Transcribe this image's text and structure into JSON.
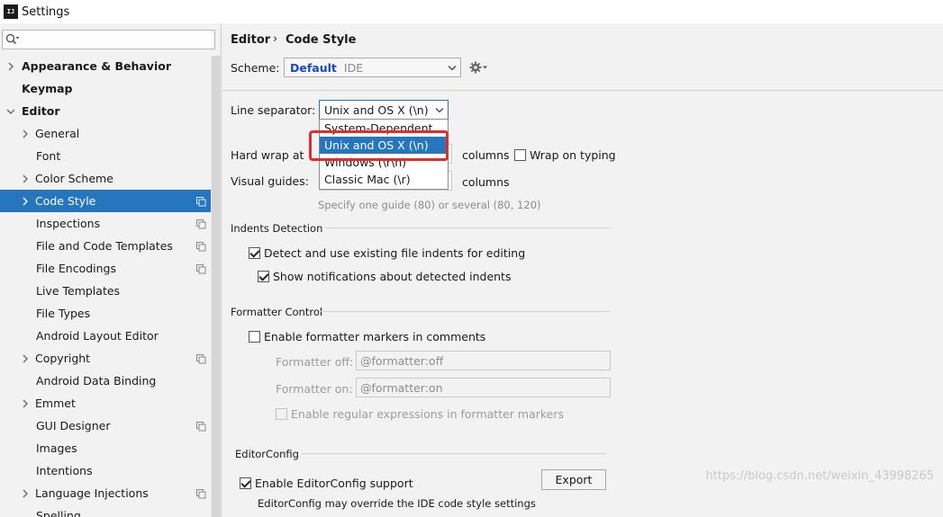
{
  "window": {
    "title": "Settings",
    "app_icon": "IJ"
  },
  "sidebar": {
    "search": {
      "placeholder": ""
    },
    "items": [
      {
        "label": "Appearance & Behavior",
        "level": 0,
        "arrow": "right",
        "bold": true
      },
      {
        "label": "Keymap",
        "level": 0,
        "arrow": null,
        "bold": true
      },
      {
        "label": "Editor",
        "level": 0,
        "arrow": "down",
        "bold": true
      },
      {
        "label": "General",
        "level": 1,
        "arrow": "right"
      },
      {
        "label": "Font",
        "level": 1,
        "arrow": null
      },
      {
        "label": "Color Scheme",
        "level": 1,
        "arrow": "right"
      },
      {
        "label": "Code Style",
        "level": 1,
        "arrow": "right",
        "selected": true,
        "copy_icon": true
      },
      {
        "label": "Inspections",
        "level": 1,
        "arrow": null,
        "copy_icon": true
      },
      {
        "label": "File and Code Templates",
        "level": 1,
        "arrow": null,
        "copy_icon": true
      },
      {
        "label": "File Encodings",
        "level": 1,
        "arrow": null,
        "copy_icon": true
      },
      {
        "label": "Live Templates",
        "level": 1,
        "arrow": null
      },
      {
        "label": "File Types",
        "level": 1,
        "arrow": null
      },
      {
        "label": "Android Layout Editor",
        "level": 1,
        "arrow": null
      },
      {
        "label": "Copyright",
        "level": 1,
        "arrow": "right",
        "copy_icon": true
      },
      {
        "label": "Android Data Binding",
        "level": 1,
        "arrow": null
      },
      {
        "label": "Emmet",
        "level": 1,
        "arrow": "right"
      },
      {
        "label": "GUI Designer",
        "level": 1,
        "arrow": null,
        "copy_icon": true
      },
      {
        "label": "Images",
        "level": 1,
        "arrow": null
      },
      {
        "label": "Intentions",
        "level": 1,
        "arrow": null
      },
      {
        "label": "Language Injections",
        "level": 1,
        "arrow": "right",
        "copy_icon": true
      },
      {
        "label": "Spelling",
        "level": 1,
        "arrow": null
      }
    ]
  },
  "breadcrumb": {
    "parent": "Editor",
    "separator": "›",
    "current": "Code Style"
  },
  "scheme": {
    "label": "Scheme:",
    "name": "Default",
    "scope": "IDE"
  },
  "line_separator": {
    "label": "Line separator:",
    "value": "Unix and OS X (\\n)",
    "options": [
      {
        "label": "System-Dependent"
      },
      {
        "label": "Unix and OS X (\\n)",
        "selected": true
      },
      {
        "label": "Windows (\\r\\n)"
      },
      {
        "label": "Classic Mac (\\r)"
      }
    ]
  },
  "hard_wrap": {
    "label": "Hard wrap at",
    "unit": "columns",
    "wrap_on_typing_label": "Wrap on typing",
    "wrap_on_typing": false
  },
  "visual_guides": {
    "label": "Visual guides:",
    "unit": "columns",
    "hint": "Specify one guide (80) or several (80, 120)"
  },
  "indents_detection": {
    "title": "Indents Detection",
    "detect_label": "Detect and use existing file indents for editing",
    "detect": true,
    "notify_label": "Show notifications about detected indents",
    "notify": true
  },
  "formatter_control": {
    "title": "Formatter Control",
    "enable_label": "Enable formatter markers in comments",
    "enable": false,
    "off_label": "Formatter off:",
    "off_value": "@formatter:off",
    "on_label": "Formatter on:",
    "on_value": "@formatter:on",
    "regex_label": "Enable regular expressions in formatter markers",
    "regex": false
  },
  "editorconfig": {
    "title": "EditorConfig",
    "enable_label": "Enable EditorConfig support",
    "enable": true,
    "note": "EditorConfig may override the IDE code style settings",
    "export_label": "Export"
  },
  "watermark": "https://blog.csdn.net/weixin_43998265",
  "colors": {
    "selection": "#2675bf",
    "highlight": "#e52c2c",
    "scheme_name": "#1a47c9"
  }
}
